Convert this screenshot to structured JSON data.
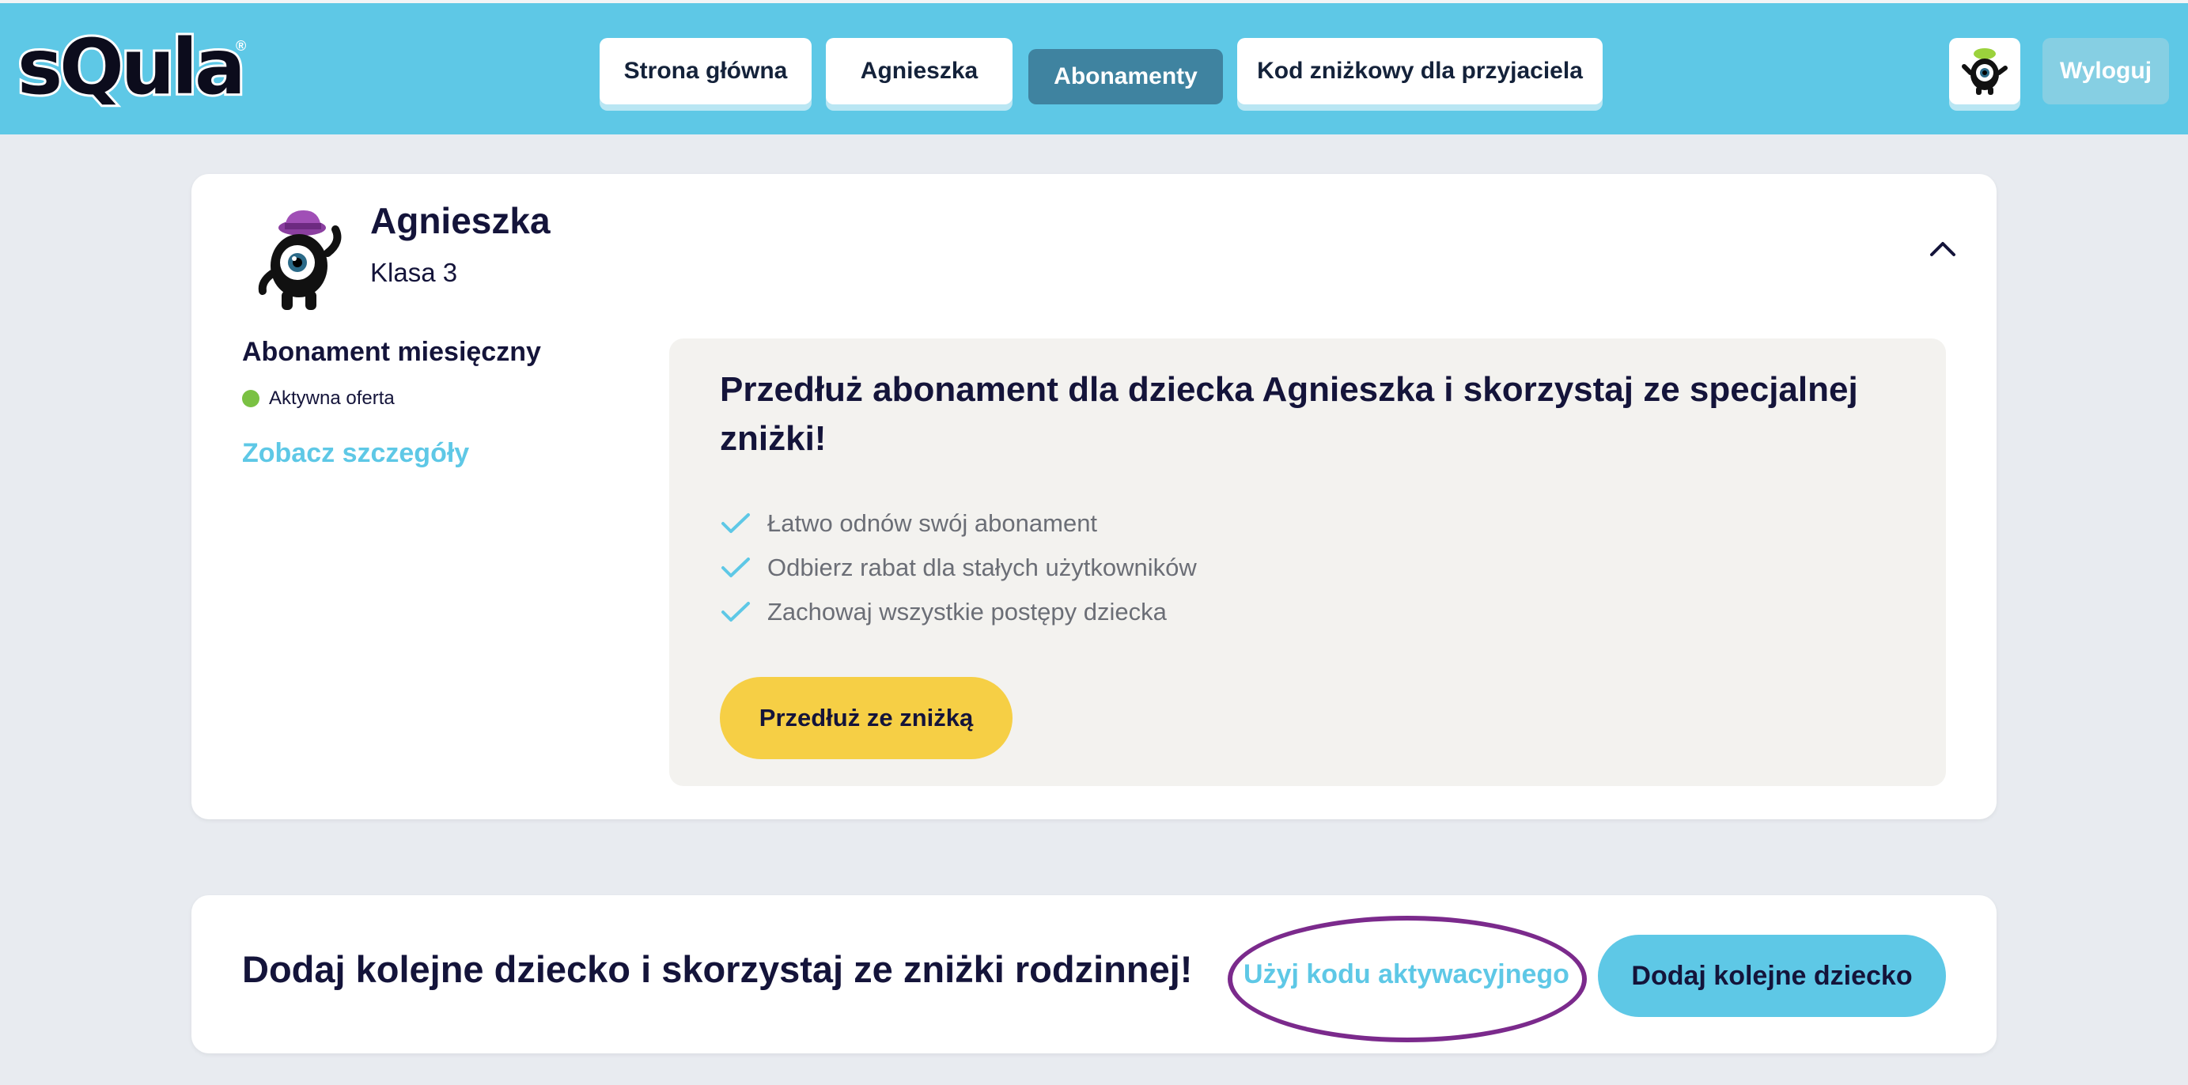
{
  "brand": {
    "name": "sQula",
    "registered": "®"
  },
  "nav": {
    "items": [
      {
        "label": "Strona główna",
        "active": false
      },
      {
        "label": "Agnieszka",
        "active": false
      },
      {
        "label": "Abonamenty",
        "active": true
      },
      {
        "label": "Kod zniżkowy dla przyjaciela",
        "active": false
      }
    ],
    "logout_label": "Wyloguj"
  },
  "child": {
    "name": "Agnieszka",
    "class_label": "Klasa 3",
    "subscription_title": "Abonament miesięczny",
    "status_label": "Aktywna oferta",
    "details_link": "Zobacz szczegóły"
  },
  "offer": {
    "title": "Przedłuż abonament dla dziecka Agnieszka i skorzystaj ze specjalnej zniżki!",
    "benefits": [
      "Łatwo odnów swój abonament",
      "Odbierz rabat dla stałych użytkowników",
      "Zachowaj wszystkie postępy dziecka"
    ],
    "cta_label": "Przedłuż ze zniżką"
  },
  "family": {
    "text": "Dodaj kolejne dziecko i skorzystaj ze zniżki rodzinnej!",
    "activation_link": "Użyj kodu aktywacyjnego",
    "add_child_label": "Dodaj kolejne dziecko"
  },
  "colors": {
    "topbar": "#5ec8e6",
    "nav_active": "#3f83a0",
    "status_active": "#7ac143",
    "cta_yellow": "#f6cf45",
    "highlight_ring": "#7b2a8c",
    "link": "#5ec8e6"
  },
  "icons": {
    "collapse": "chevron-up-icon",
    "benefit": "check-icon",
    "avatar": "monster-avatar-icon"
  }
}
